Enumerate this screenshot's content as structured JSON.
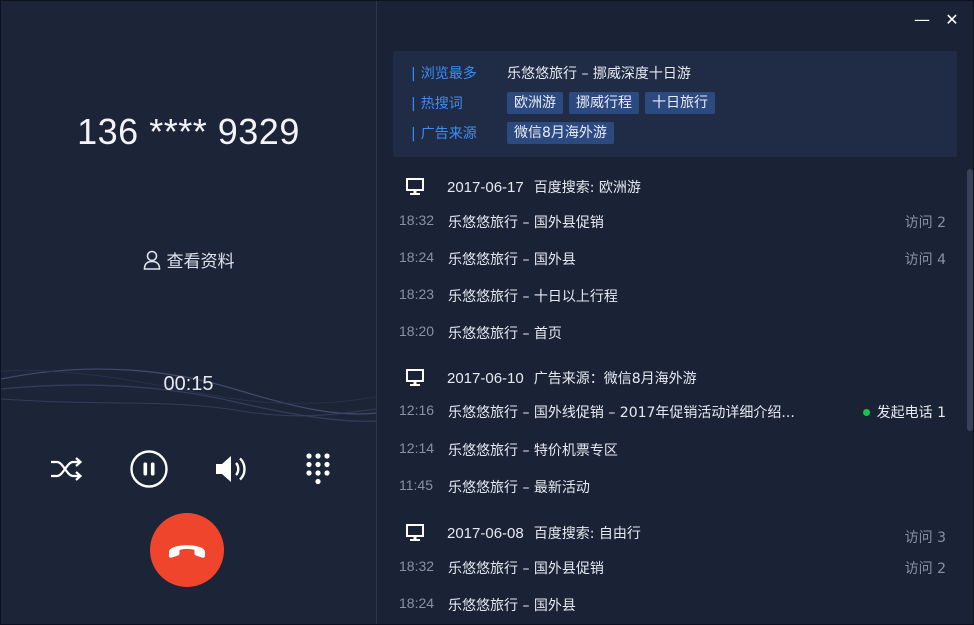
{
  "call": {
    "phone": "136 **** 9329",
    "profile_label": "查看资料",
    "timer": "00:15",
    "colors": {
      "hangup": "#f0452d",
      "panel": "#1c2438"
    },
    "controls": [
      {
        "name": "transfer-button",
        "icon": "shuffle-icon"
      },
      {
        "name": "pause-button",
        "icon": "pause-circle-icon"
      },
      {
        "name": "volume-button",
        "icon": "speaker-icon"
      },
      {
        "name": "keypad-button",
        "icon": "dialpad-icon"
      }
    ]
  },
  "window": {
    "minimize": "—",
    "close": "✕"
  },
  "summary": {
    "most_viewed_label": "浏览最多",
    "most_viewed_value": "乐悠悠旅行 – 挪威深度十日游",
    "hot_search_label": "热搜词",
    "hot_search_tags": [
      "欧洲游",
      "挪威行程",
      "十日旅行"
    ],
    "ad_source_label": "广告来源",
    "ad_source_tags": [
      "微信8月海外游"
    ]
  },
  "sessions": [
    {
      "date": "2017-06-17",
      "source": "百度搜索: 欧洲游",
      "visits": "",
      "items": [
        {
          "time": "18:32",
          "title": "乐悠悠旅行 – 国外县促销",
          "visits": "访问 2"
        },
        {
          "time": "18:24",
          "title": "乐悠悠旅行 – 国外县",
          "visits": "访问 4"
        },
        {
          "time": "18:23",
          "title": "乐悠悠旅行 – 十日以上行程",
          "visits": ""
        },
        {
          "time": "18:20",
          "title": "乐悠悠旅行 – 首页",
          "visits": ""
        }
      ]
    },
    {
      "date": "2017-06-10",
      "source": "广告来源：微信8月海外游",
      "visits": "",
      "items": [
        {
          "time": "12:16",
          "title": "乐悠悠旅行 – 国外线促销 – 2017年促销活动详细介绍...",
          "call": "发起电话 1"
        },
        {
          "time": "12:14",
          "title": "乐悠悠旅行 – 特价机票专区",
          "visits": ""
        },
        {
          "time": "11:45",
          "title": "乐悠悠旅行 – 最新活动",
          "visits": ""
        }
      ]
    },
    {
      "date": "2017-06-08",
      "source": "百度搜索: 自由行",
      "visits": "访问 3",
      "items": [
        {
          "time": "18:32",
          "title": "乐悠悠旅行 – 国外县促销",
          "visits": "访问 2"
        },
        {
          "time": "18:24",
          "title": "乐悠悠旅行 – 国外县",
          "visits": ""
        }
      ]
    }
  ]
}
